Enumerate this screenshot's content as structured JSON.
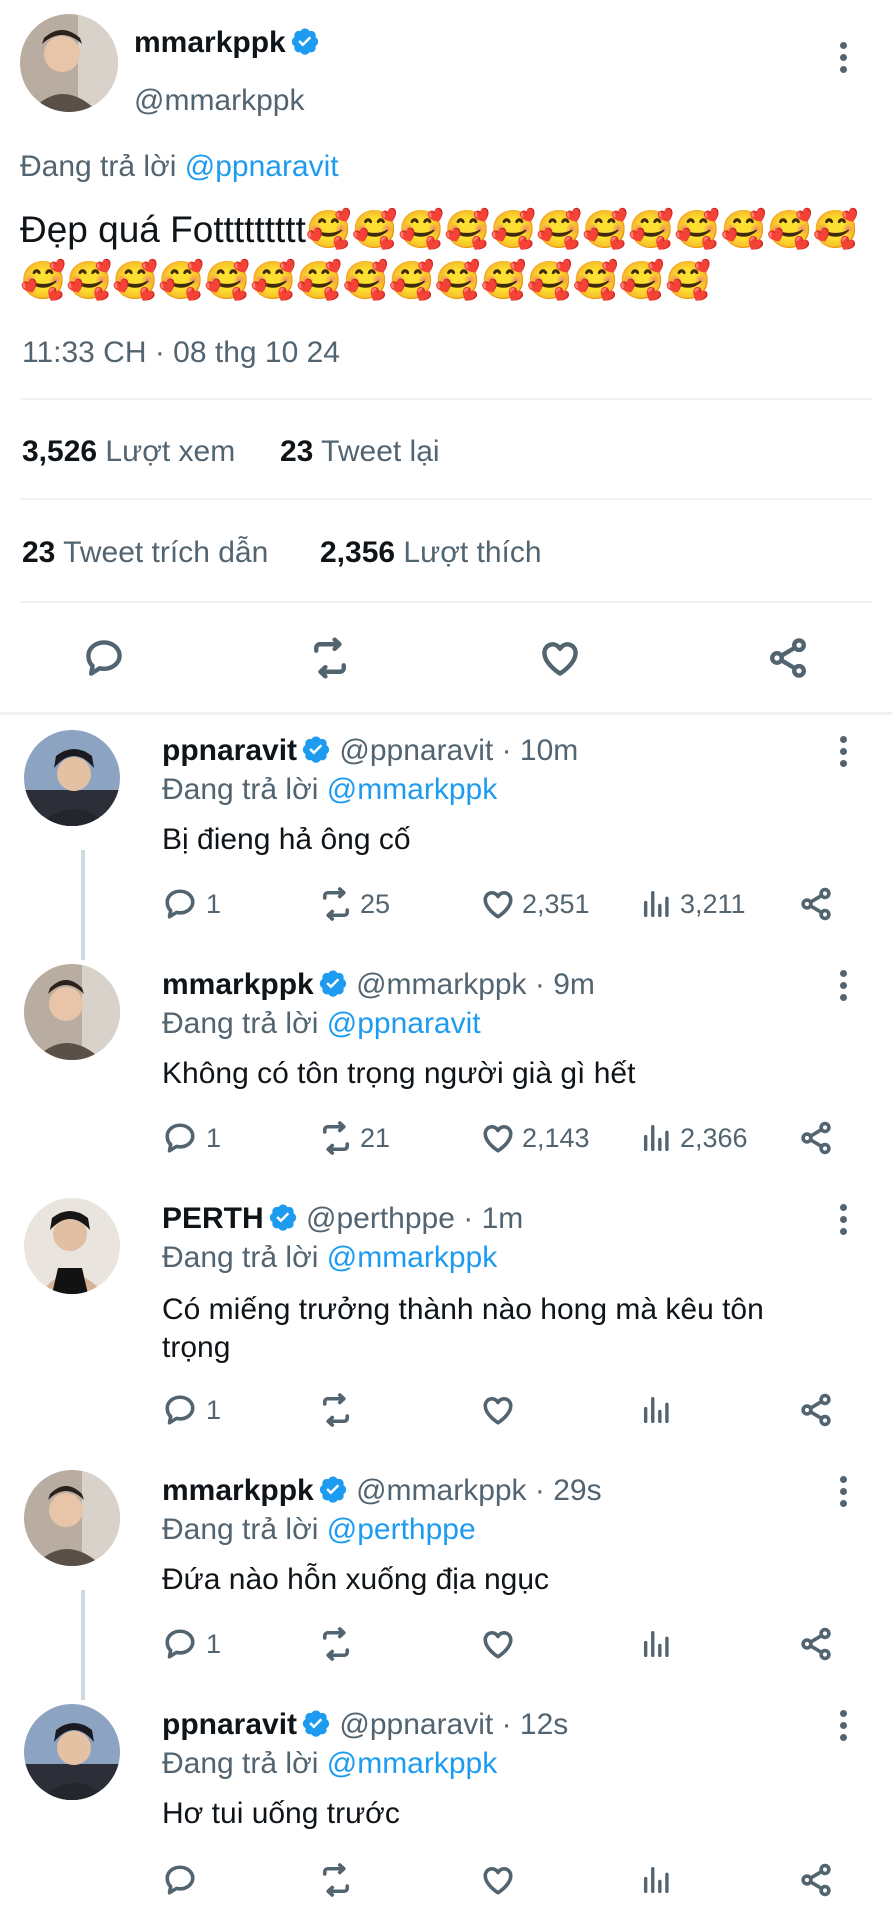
{
  "main_tweet": {
    "display_name": "mmarkppk",
    "handle": "@mmarkppk",
    "replying_prefix": "Đang trả lời ",
    "replying_to": "@ppnaravit",
    "text": "Đẹp quá Fottttttttt🥰🥰🥰🥰🥰🥰🥰🥰🥰🥰🥰🥰🥰🥰🥰🥰🥰🥰🥰🥰🥰🥰🥰🥰🥰🥰🥰",
    "timestamp": "11:33 CH · 08 thg 10 24",
    "stats": {
      "views_count": "3,526",
      "views_label": "Lượt xem",
      "retweets_count": "23",
      "retweets_label": "Tweet lại",
      "quotes_count": "23",
      "quotes_label": "Tweet trích dẫn",
      "likes_count": "2,356",
      "likes_label": "Lượt thích"
    }
  },
  "replies": [
    {
      "display_name": "ppnaravit",
      "handle": "@ppnaravit",
      "time": "10m",
      "replying_prefix": "Đang trả lời ",
      "replying_to": "@mmarkppk",
      "text": "Bị đieng hả ông cố",
      "replies": "1",
      "retweets": "25",
      "likes": "2,351",
      "views": "3,211"
    },
    {
      "display_name": "mmarkppk",
      "handle": "@mmarkppk",
      "time": "9m",
      "replying_prefix": "Đang trả lời ",
      "replying_to": "@ppnaravit",
      "text": "Không có tôn trọng người già gì hết",
      "replies": "1",
      "retweets": "21",
      "likes": "2,143",
      "views": "2,366"
    },
    {
      "display_name": "PERTH",
      "handle": "@perthppe",
      "time": "1m",
      "replying_prefix": "Đang trả lời ",
      "replying_to": "@mmarkppk",
      "text_line1": "Có miếng trưởng thành nào hong mà kêu tôn",
      "text_line2": "trọng",
      "replies": "1",
      "retweets": "",
      "likes": "",
      "views": ""
    },
    {
      "display_name": "mmarkppk",
      "handle": "@mmarkppk",
      "time": "29s",
      "replying_prefix": "Đang trả lời ",
      "replying_to": "@perthppe",
      "text": "Đứa nào hỗn xuống địa ngục",
      "replies": "1",
      "retweets": "",
      "likes": "",
      "views": ""
    },
    {
      "display_name": "ppnaravit",
      "handle": "@ppnaravit",
      "time": "12s",
      "replying_prefix": "Đang trả lời ",
      "replying_to": "@mmarkppk",
      "text": "Hơ tui uống trước",
      "replies": "",
      "retweets": "",
      "likes": "",
      "views": ""
    }
  ],
  "separator": " · ",
  "colors": {
    "link": "#1d9bf0",
    "muted": "#536471",
    "divider": "#eff3f4"
  },
  "icons": [
    "verified-badge-icon",
    "more-options-icon",
    "reply-icon",
    "retweet-icon",
    "like-icon",
    "share-icon",
    "views-icon"
  ]
}
